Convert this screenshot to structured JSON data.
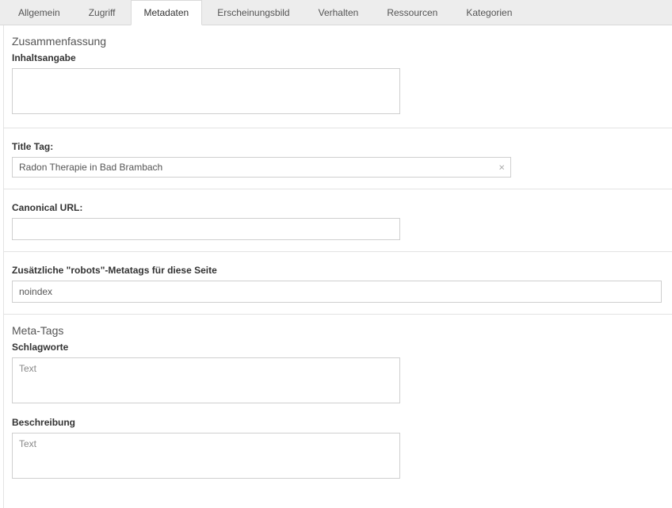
{
  "tabs": {
    "general": "Allgemein",
    "access": "Zugriff",
    "metadata": "Metadaten",
    "appearance": "Erscheinungsbild",
    "behavior": "Verhalten",
    "resources": "Ressourcen",
    "categories": "Kategorien"
  },
  "summary": {
    "heading": "Zusammenfassung",
    "abstract_label": "Inhaltsangabe",
    "abstract_value": ""
  },
  "titletag": {
    "label": "Title Tag:",
    "value": "Radon Therapie in Bad Brambach"
  },
  "canonical": {
    "label": "Canonical URL:",
    "value": ""
  },
  "robots": {
    "label": "Zusätzliche \"robots\"-Metatags für diese Seite",
    "value": "noindex"
  },
  "metatags": {
    "heading": "Meta-Tags",
    "keywords_label": "Schlagworte",
    "keywords_placeholder": "Text",
    "keywords_value": "",
    "description_label": "Beschreibung",
    "description_placeholder": "Text",
    "description_value": ""
  }
}
